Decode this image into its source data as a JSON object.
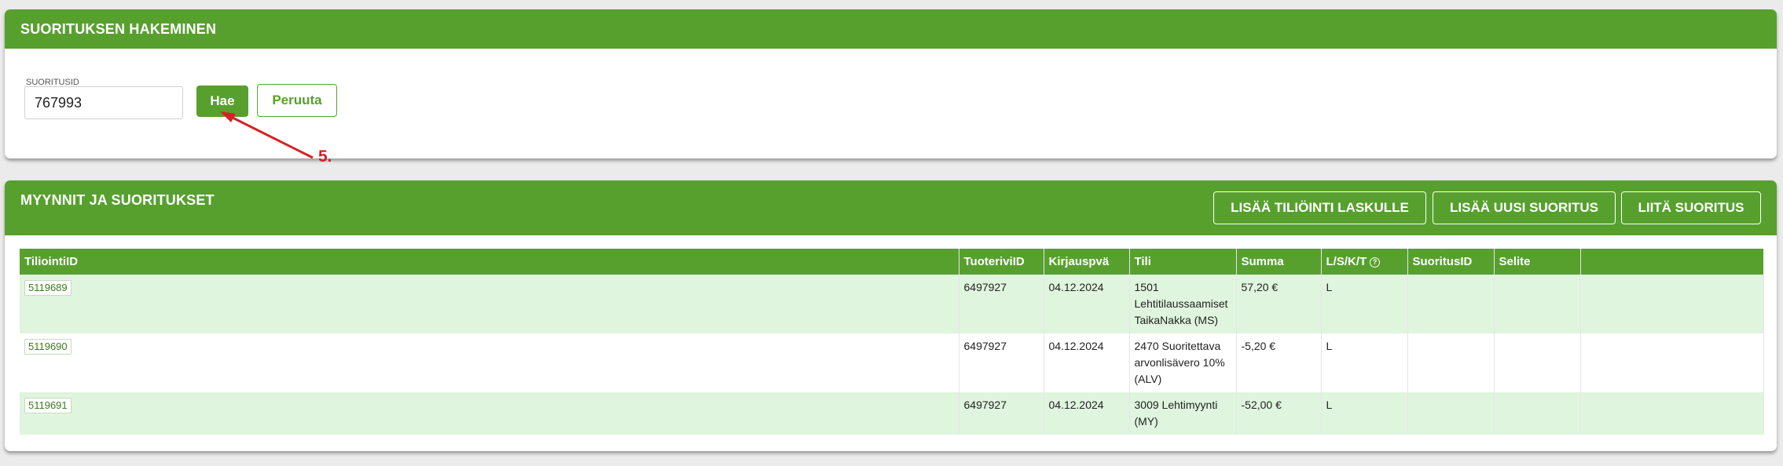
{
  "search": {
    "title": "SUORITUKSEN HAKEMINEN",
    "field_label": "SUORITUSID",
    "field_value": "767993",
    "search_button": "Hae",
    "cancel_button": "Peruuta"
  },
  "annotation": {
    "label": "5.",
    "color": "#d81f26"
  },
  "results": {
    "title": "MYYNNIT JA SUORITUKSET",
    "buttons": {
      "add_posting": "LISÄÄ TILIÖINTI LASKULLE",
      "add_payment": "LISÄÄ UUSI SUORITUS",
      "attach_payment": "LIITÄ SUORITUS"
    },
    "columns": [
      "TiliointiID",
      "TuoteriviID",
      "Kirjauspvä",
      "Tili",
      "Summa",
      "L/S/K/T",
      "SuoritusID",
      "Selite",
      ""
    ],
    "info_icon": "info-circle-icon",
    "rows": [
      {
        "tiliointi_id": "5119689",
        "tuoterivi_id": "6497927",
        "kirjauspva": "04.12.2024",
        "tili": "1501 Lehtitilaussaamiset TaikaNakka (MS)",
        "summa": "57,20 €",
        "lskt": "L",
        "suoritus_id": "",
        "selite": ""
      },
      {
        "tiliointi_id": "5119690",
        "tuoterivi_id": "6497927",
        "kirjauspva": "04.12.2024",
        "tili": "2470 Suoritettava arvonlisävero 10% (ALV)",
        "summa": "-5,20 €",
        "lskt": "L",
        "suoritus_id": "",
        "selite": ""
      },
      {
        "tiliointi_id": "5119691",
        "tuoterivi_id": "6497927",
        "kirjauspva": "04.12.2024",
        "tili": "3009 Lehtimyynti (MY)",
        "summa": "-52,00 €",
        "lskt": "L",
        "suoritus_id": "",
        "selite": ""
      }
    ]
  },
  "colors": {
    "brand_green": "#57a02e",
    "row_highlight": "#dff5de",
    "annotation_red": "#d81f26"
  }
}
